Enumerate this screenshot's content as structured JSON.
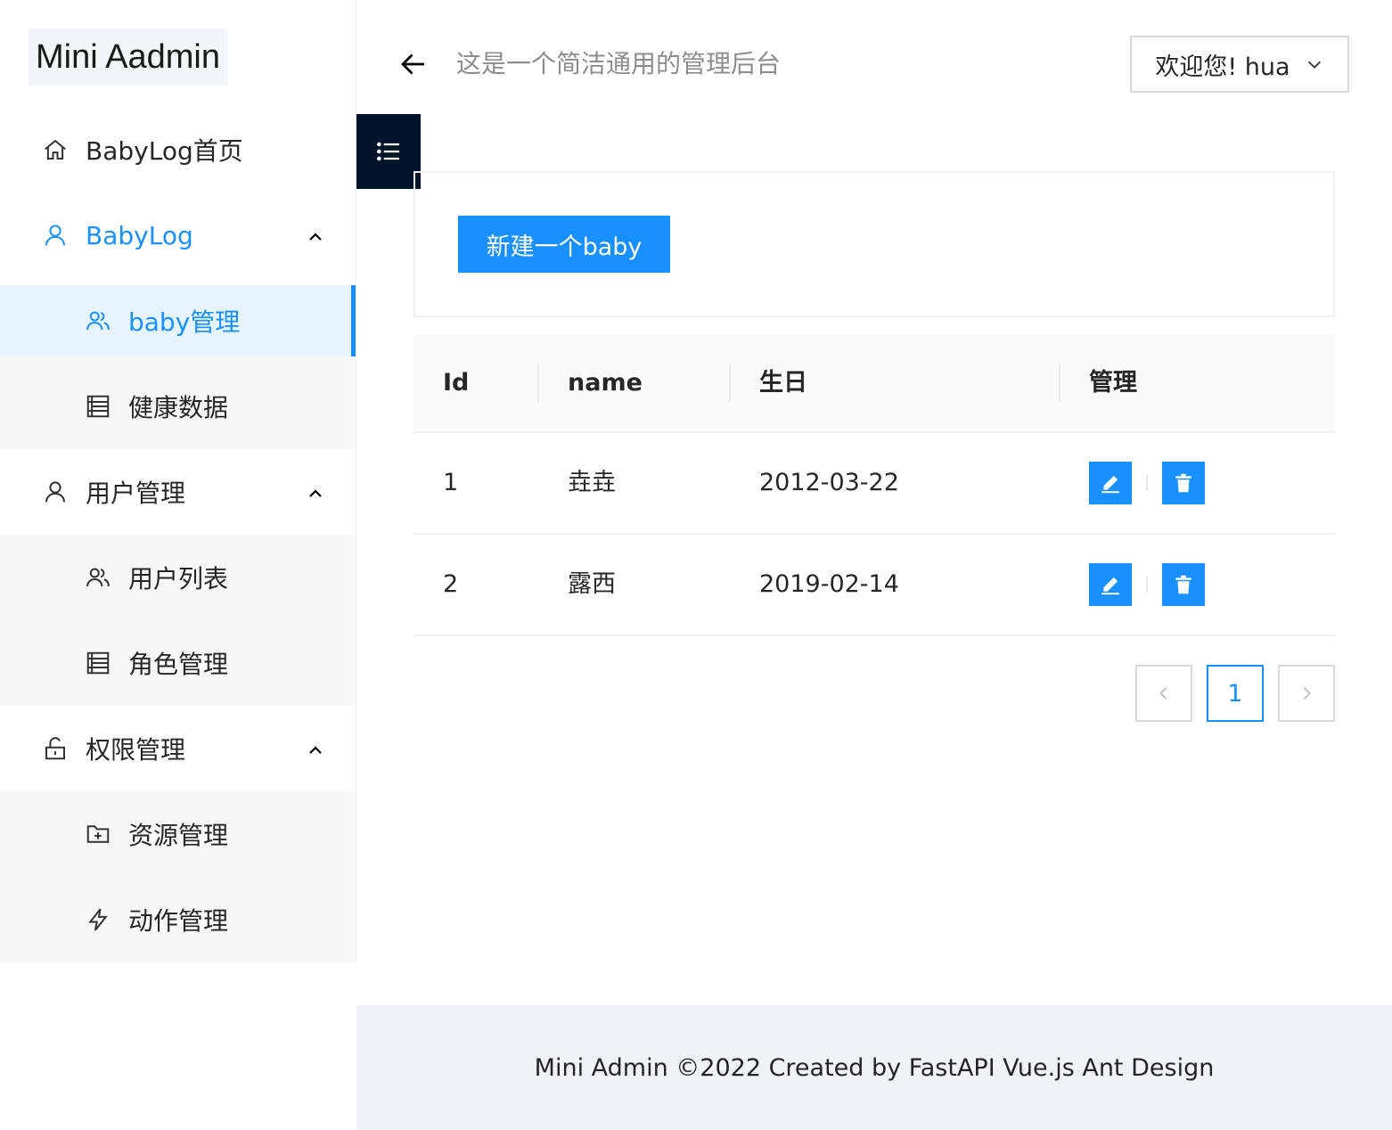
{
  "app": {
    "logo": "Mini Aadmin",
    "subtitle": "这是一个简洁通用的管理后台",
    "user_menu": "欢迎您! hua"
  },
  "sidebar": {
    "items": [
      {
        "label": "BabyLog首页",
        "icon": "home-icon"
      },
      {
        "label": "BabyLog",
        "icon": "user-icon",
        "open": true
      },
      {
        "label": "baby管理",
        "icon": "team-icon",
        "selected": true
      },
      {
        "label": "健康数据",
        "icon": "table-icon"
      },
      {
        "label": "用户管理",
        "icon": "user-icon",
        "open": true
      },
      {
        "label": "用户列表",
        "icon": "team-icon"
      },
      {
        "label": "角色管理",
        "icon": "table-icon"
      },
      {
        "label": "权限管理",
        "icon": "unlock-icon",
        "open": true
      },
      {
        "label": "资源管理",
        "icon": "folder-add-icon"
      },
      {
        "label": "动作管理",
        "icon": "thunderbolt-icon"
      }
    ]
  },
  "toolbar": {
    "create_label": "新建一个baby"
  },
  "table": {
    "columns": [
      "Id",
      "name",
      "生日",
      "管理"
    ],
    "rows": [
      {
        "id": "1",
        "name": "垚垚",
        "birthday": "2012-03-22"
      },
      {
        "id": "2",
        "name": "露西",
        "birthday": "2019-02-14"
      }
    ]
  },
  "pagination": {
    "current": "1"
  },
  "footer": {
    "text": "Mini Admin ©2022 Created by FastAPI Vue.js Ant Design"
  },
  "colors": {
    "primary": "#1890ff",
    "sider_dark": "#001529",
    "footer_bg": "#f0f2f5"
  }
}
